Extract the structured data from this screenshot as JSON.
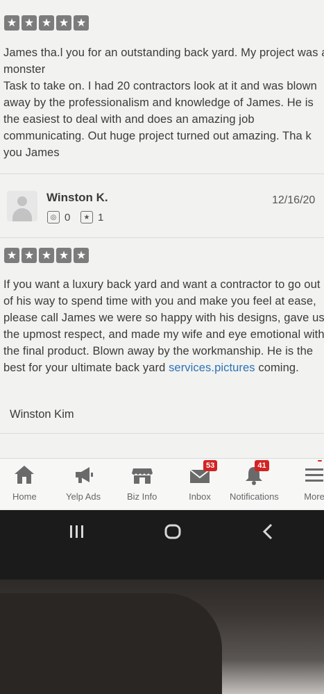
{
  "review1": {
    "rating": 5,
    "text": "James tha.l you for an outstanding back yard. My project was a monster\nTask to take on. I had 20 contractors look at it and was blown away by the professionalism and knowledge of James. He is the easiest to deal with and does an amazing job communicating. Out huge project turned out amazing. Tha k you James"
  },
  "review2": {
    "reviewer_name": "Winston K.",
    "date": "12/16/20",
    "photo_count": "0",
    "review_count": "1",
    "rating": 5,
    "text_before_link": "If you want a luxury back yard and want a contractor to go out of his way to spend time with you and make you feel at ease, please call James we were so happy with his designs, gave us the upmost respect, and made my wife and eye emotional with the final product. Blown away by the workmanship. He is the best for your ultimate back yard ",
    "link_text": "services.pictures",
    "text_after_link": " coming.",
    "signature": "Winston Kim"
  },
  "tabbar": {
    "home": "Home",
    "yelp_ads": "Yelp Ads",
    "biz_info": "Biz Info",
    "inbox": "Inbox",
    "inbox_badge": "53",
    "notifications": "Notifications",
    "notifications_badge": "41",
    "more": "More"
  },
  "colors": {
    "star_gray": "#7c7c7c",
    "badge_red": "#d32323",
    "link_blue": "#2a72b8",
    "text_dark": "#3a3a3a"
  }
}
